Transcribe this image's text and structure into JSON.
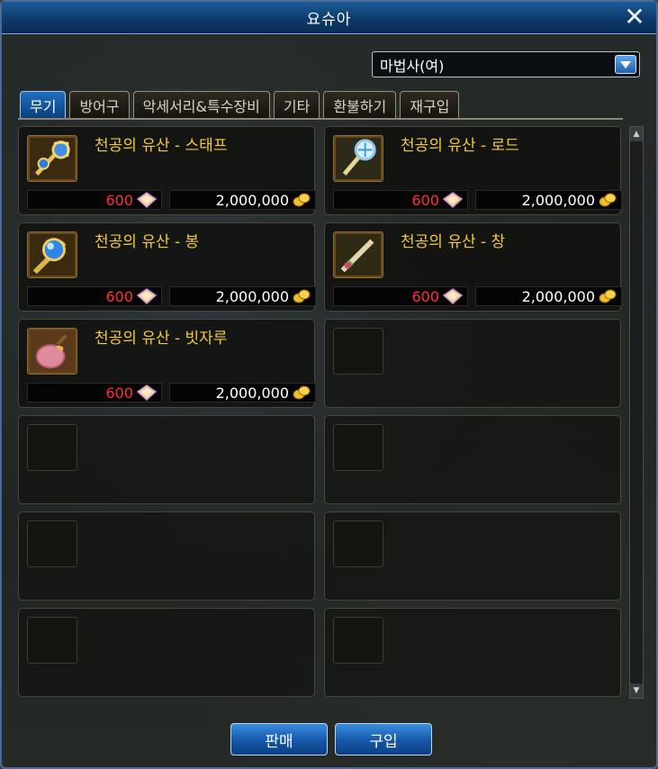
{
  "window": {
    "title": "요슈아"
  },
  "class_select": {
    "value": "마법사(여)"
  },
  "tabs": [
    {
      "label": "무기",
      "active": true
    },
    {
      "label": "방어구",
      "active": false
    },
    {
      "label": "악세서리&특수장비",
      "active": false
    },
    {
      "label": "기타",
      "active": false
    },
    {
      "label": "환불하기",
      "active": false
    },
    {
      "label": "재구입",
      "active": false
    }
  ],
  "items": [
    {
      "name": "천공의 유산 - 스태프",
      "icon": "staff-icon",
      "points": "600",
      "gold": "2,000,000"
    },
    {
      "name": "천공의 유산 - 로드",
      "icon": "rod-icon",
      "points": "600",
      "gold": "2,000,000"
    },
    {
      "name": "천공의 유산 - 봉",
      "icon": "pole-icon",
      "points": "600",
      "gold": "2,000,000"
    },
    {
      "name": "천공의 유산 - 창",
      "icon": "spear-icon",
      "points": "600",
      "gold": "2,000,000"
    },
    {
      "name": "천공의 유산 - 빗자루",
      "icon": "broom-icon",
      "points": "600",
      "gold": "2,000,000"
    }
  ],
  "colors": {
    "item_name": "#f2c93a",
    "points": "#ff2e2e",
    "gold_amount": "#ffffff",
    "accent_blue": "#1f6fc0"
  },
  "buttons": {
    "sell": "판매",
    "buy": "구입"
  }
}
